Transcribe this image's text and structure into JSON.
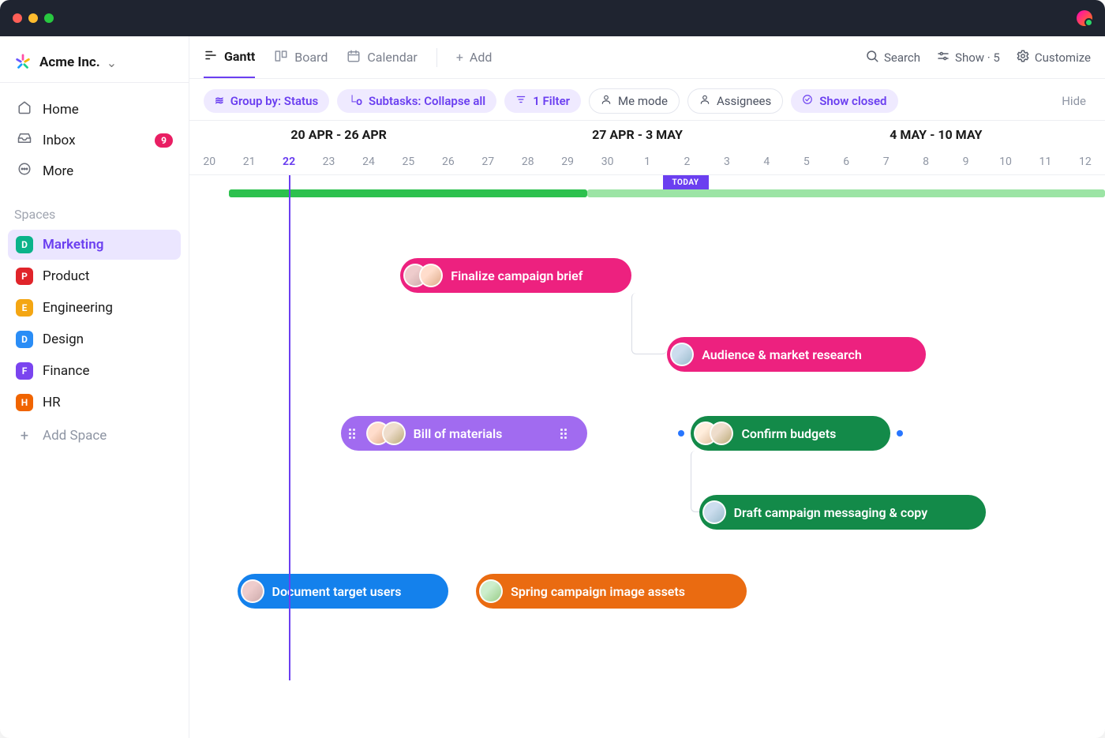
{
  "workspace": {
    "name": "Acme Inc."
  },
  "nav": {
    "home": "Home",
    "inbox": "Inbox",
    "inbox_count": "9",
    "more": "More"
  },
  "spaces_label": "Spaces",
  "spaces": [
    {
      "letter": "D",
      "label": "Marketing",
      "color": "#0bb38a",
      "active": true
    },
    {
      "letter": "P",
      "label": "Product",
      "color": "#e0242a"
    },
    {
      "letter": "E",
      "label": "Engineering",
      "color": "#f4a613"
    },
    {
      "letter": "D",
      "label": "Design",
      "color": "#2a8df6"
    },
    {
      "letter": "F",
      "label": "Finance",
      "color": "#7a44ef"
    },
    {
      "letter": "H",
      "label": "HR",
      "color": "#f06400"
    }
  ],
  "add_space": "Add Space",
  "tabs": [
    {
      "id": "gantt",
      "label": "Gantt",
      "active": true
    },
    {
      "id": "board",
      "label": "Board"
    },
    {
      "id": "calendar",
      "label": "Calendar"
    },
    {
      "id": "add",
      "label": "Add"
    }
  ],
  "toolbar": {
    "search": "Search",
    "show": "Show · 5",
    "customize": "Customize"
  },
  "filters": {
    "group_by": "Group by: Status",
    "subtasks": "Subtasks: Collapse all",
    "filter": "1 Filter",
    "me_mode": "Me mode",
    "assignees": "Assignees",
    "show_closed": "Show closed",
    "hide": "Hide"
  },
  "timeline": {
    "today_label": "TODAY",
    "weeks": [
      "20 APR - 26 APR",
      "27 APR - 3 MAY",
      "4 MAY - 10 MAY"
    ],
    "days": [
      "20",
      "21",
      "22",
      "23",
      "24",
      "25",
      "26",
      "27",
      "28",
      "29",
      "30",
      "1",
      "2",
      "3",
      "4",
      "5",
      "6",
      "7",
      "8",
      "9",
      "10",
      "11",
      "12"
    ],
    "today_index": 2
  },
  "tasks": {
    "finalize": "Finalize campaign brief",
    "audience": "Audience & market research",
    "bom": "Bill of materials",
    "budgets": "Confirm budgets",
    "draft": "Draft campaign messaging & copy",
    "dtu": "Document target users",
    "assets": "Spring campaign image assets"
  },
  "colors": {
    "pink": "#ed217f",
    "purple": "#a16bf0",
    "green": "#138a49",
    "blue": "#1481ec",
    "orange": "#ea6b11"
  }
}
